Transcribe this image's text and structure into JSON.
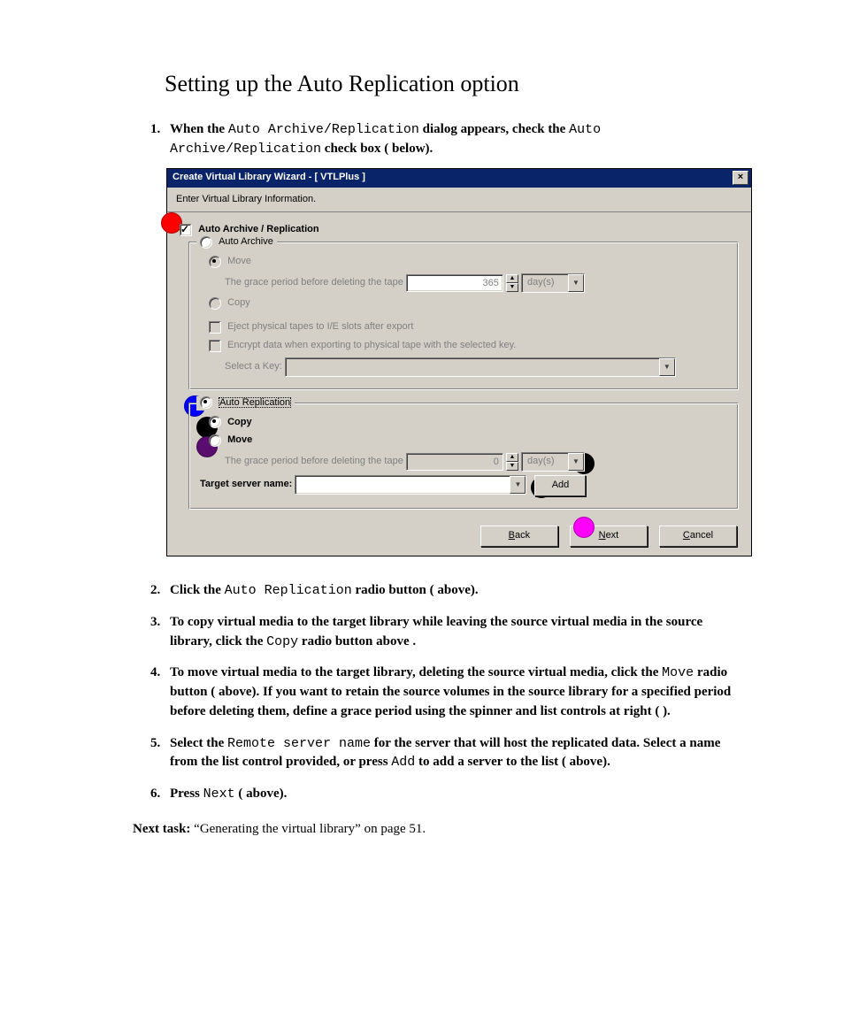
{
  "heading": "Setting up the Auto Replication option",
  "steps": {
    "s1a": "When the ",
    "s1b": "Auto Archive/Replication",
    "s1c": " dialog appears, check the ",
    "s1d": "Auto Archive/Replication",
    "s1e": " check box (   below).",
    "s2a": "Click the ",
    "s2b": "Auto Replication",
    "s2c": " radio button (   above).",
    "s3a": "To copy virtual media to the target library while leaving the source virtual media in the source library, click the ",
    "s3b": "Copy",
    "s3c": " radio button     above .",
    "s4a": "To move virtual media to the target library, deleting the source virtual media, click the ",
    "s4b": "Move",
    "s4c": " radio button (   above). If you want to retain the source volumes in the source library for a specified period before deleting them, define a grace period using the spinner and list controls at right (  ).",
    "s5a": "Select the ",
    "s5b": "Remote server name",
    "s5c": " for the server that will host the replicated data. Select a name from the list control provided, or press ",
    "s5d": "Add",
    "s5e": " to add a server to the list (   above).",
    "s6a": "Press ",
    "s6b": "Next",
    "s6c": " (   above)."
  },
  "next_task_label": "Next task:",
  "next_task_text": "  “Generating the virtual library” on page 51.",
  "dialog": {
    "title": "Create Virtual Library Wizard - [ VTLPlus ]",
    "subtitle": "Enter Virtual Library Information.",
    "auto_archive_repl": "Auto Archive / Replication",
    "auto_archive": "Auto Archive",
    "move": "Move",
    "copy": "Copy",
    "grace_label": "The grace period before deleting the tape",
    "grace_value_365": "365",
    "grace_value_0": "0",
    "unit_days": "day(s)",
    "eject": "Eject physical tapes to I/E slots after export",
    "encrypt": "Encrypt data when exporting to physical tape with the selected key.",
    "select_key": "Select a Key:",
    "auto_replication": "Auto Replication",
    "copy_b": "Copy",
    "move_b": "Move",
    "target_server": "Target server name:",
    "add": "Add",
    "back": "Back",
    "next": "Next",
    "cancel": "Cancel"
  }
}
